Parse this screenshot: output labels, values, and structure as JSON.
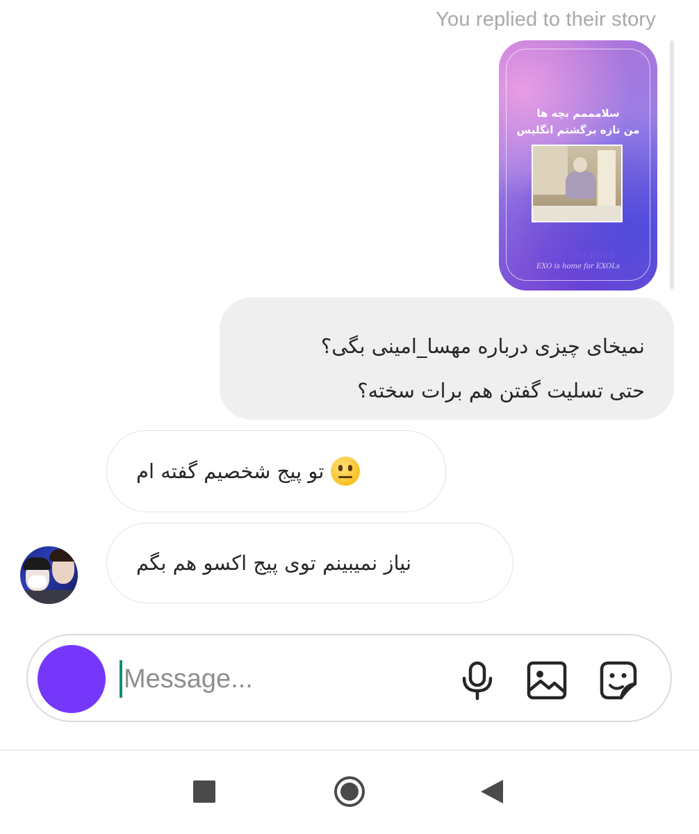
{
  "thread": {
    "reply_context": "You replied to their story",
    "story": {
      "headline_line1": "سلامممم بچه ها",
      "headline_line2": "من تازه برگشتم انگلیس",
      "brand": "EXOLOVER612",
      "tagline": "EXO is home for EXOLs"
    },
    "messages": [
      {
        "direction": "sent",
        "lines": [
          "نمیخای چیزی درباره مهسا_امینی بگی؟",
          "حتی تسلیت گفتن هم برات سخته؟"
        ]
      },
      {
        "direction": "received",
        "emoji": "neutral-face",
        "text": "تو پیج شخصیم گفته ام"
      },
      {
        "direction": "received",
        "text": "نیاز نمیبینم توی پیج اکسو  هم بگم"
      }
    ]
  },
  "composer": {
    "placeholder": "Message...",
    "value": "",
    "accent_color": "#7538fa",
    "icons": [
      "microphone-icon",
      "gallery-icon",
      "sticker-icon"
    ]
  },
  "navigation": {
    "buttons": [
      "recents",
      "home",
      "back"
    ]
  }
}
